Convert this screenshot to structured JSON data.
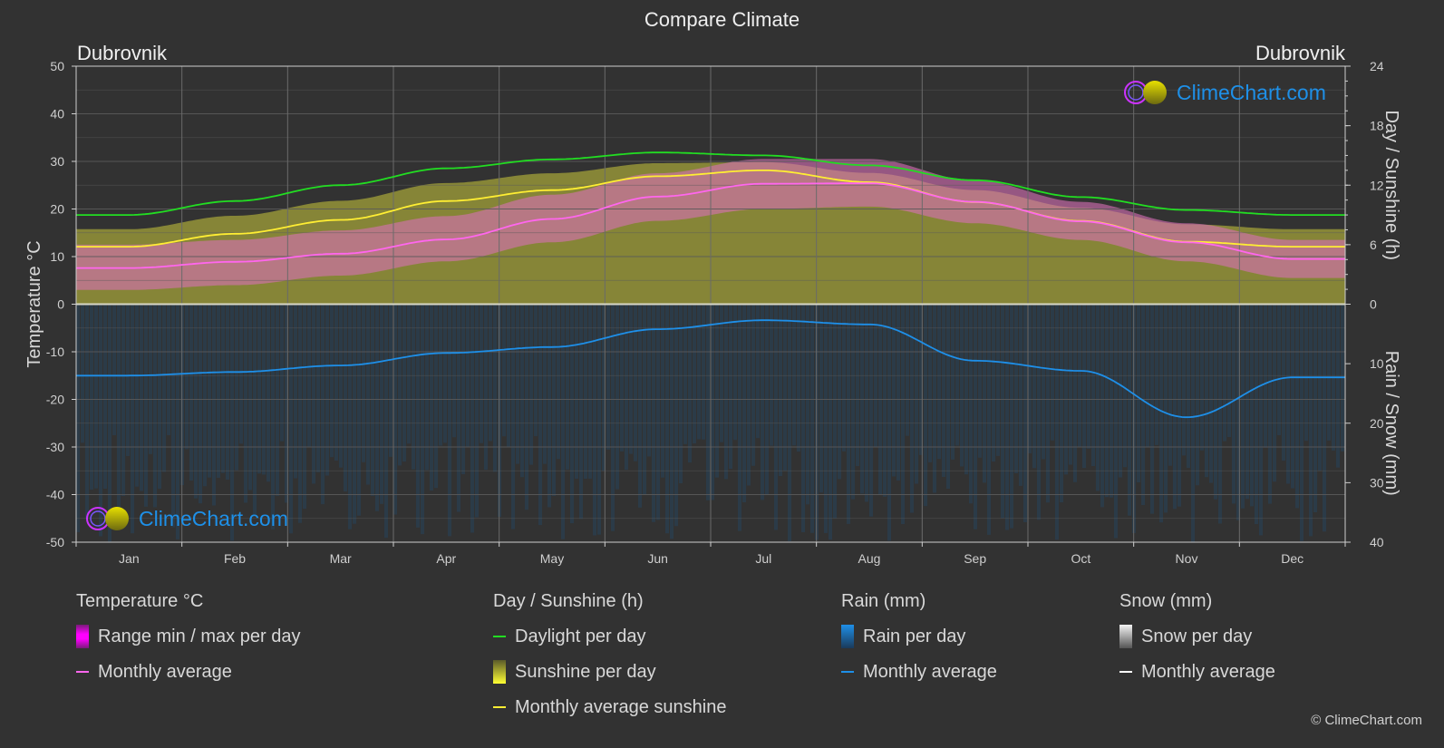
{
  "title": "Compare Climate",
  "city_left": "Dubrovnik",
  "city_right": "Dubrovnik",
  "logo_text": "ClimeChart.com",
  "copyright": "© ClimeChart.com",
  "colors": {
    "background": "#323232",
    "grid": "#5a5a5a",
    "temp_avg": "#ff66ee",
    "temp_range": "#cc33cc",
    "daylight": "#22dd22",
    "sunshine_avg": "#ffee33",
    "sunshine_fill": "#8b8a38",
    "rain_avg": "#1e8fe8",
    "rain_fill": "#1f4e72",
    "snow_avg": "#ffffff",
    "logo_text": "#1e90e8"
  },
  "legend": {
    "temperature": {
      "title": "Temperature °C",
      "items": [
        {
          "type": "bar",
          "label": "Range min / max per day"
        },
        {
          "type": "line",
          "label": "Monthly average"
        }
      ]
    },
    "sunshine": {
      "title": "Day / Sunshine (h)",
      "items": [
        {
          "type": "line",
          "label": "Daylight per day"
        },
        {
          "type": "bar",
          "label": "Sunshine per day"
        },
        {
          "type": "line",
          "label": "Monthly average sunshine"
        }
      ]
    },
    "rain": {
      "title": "Rain (mm)",
      "items": [
        {
          "type": "bar",
          "label": "Rain per day"
        },
        {
          "type": "line",
          "label": "Monthly average"
        }
      ]
    },
    "snow": {
      "title": "Snow (mm)",
      "items": [
        {
          "type": "bar",
          "label": "Snow per day"
        },
        {
          "type": "line",
          "label": "Monthly average"
        }
      ]
    }
  },
  "chart_data": {
    "type": "line",
    "title": "Compare Climate",
    "categories": [
      "Jan",
      "Feb",
      "Mar",
      "Apr",
      "May",
      "Jun",
      "Jul",
      "Aug",
      "Sep",
      "Oct",
      "Nov",
      "Dec"
    ],
    "ylabel_left": "Temperature °C",
    "ylabel_right_top": "Day / Sunshine (h)",
    "ylabel_right_bottom": "Rain / Snow (mm)",
    "y_left": {
      "range": [
        -50,
        50
      ],
      "ticks": [
        "50",
        "40",
        "30",
        "20",
        "10",
        "0",
        "-10",
        "-20",
        "-30",
        "-40",
        "-50"
      ]
    },
    "y_right_top": {
      "range": [
        0,
        24
      ],
      "ticks": [
        "24",
        "18",
        "12",
        "6",
        "0"
      ]
    },
    "y_right_bottom": {
      "range": [
        0,
        40
      ],
      "ticks": [
        "0",
        "10",
        "20",
        "30",
        "40"
      ]
    },
    "grid": true,
    "series": [
      {
        "name": "Temperature monthly average",
        "axis": "temperature",
        "unit": "°C",
        "values": [
          7.6,
          8.9,
          10.6,
          13.6,
          17.9,
          22.6,
          25.3,
          25.4,
          21.5,
          17.4,
          13.0,
          9.5
        ]
      },
      {
        "name": "Daylight per day",
        "axis": "sunshine",
        "unit": "h",
        "values": [
          9.0,
          10.4,
          12.0,
          13.7,
          14.6,
          15.3,
          15.0,
          14.0,
          12.5,
          10.8,
          9.5,
          9.0
        ]
      },
      {
        "name": "Monthly average sunshine",
        "axis": "sunshine",
        "unit": "h",
        "values": [
          5.8,
          7.1,
          8.5,
          10.4,
          11.5,
          12.9,
          13.5,
          12.3,
          10.3,
          8.4,
          6.3,
          5.8
        ]
      },
      {
        "name": "Rain monthly average",
        "axis": "rain",
        "unit": "mm",
        "values": [
          12.0,
          11.4,
          10.3,
          8.2,
          7.2,
          4.2,
          2.7,
          3.4,
          9.5,
          11.2,
          19.0,
          12.3
        ]
      },
      {
        "name": "Temperature daily max (approx.)",
        "axis": "temperature",
        "unit": "°C",
        "values": [
          12.5,
          13.5,
          15.5,
          18.5,
          23.0,
          27.5,
          30.5,
          30.5,
          26.0,
          21.5,
          17.0,
          13.5
        ]
      },
      {
        "name": "Temperature daily min (approx.)",
        "axis": "temperature",
        "unit": "°C",
        "values": [
          3.0,
          4.0,
          6.0,
          9.0,
          13.0,
          17.5,
          20.0,
          20.5,
          17.0,
          13.5,
          9.0,
          5.5
        ]
      }
    ]
  }
}
